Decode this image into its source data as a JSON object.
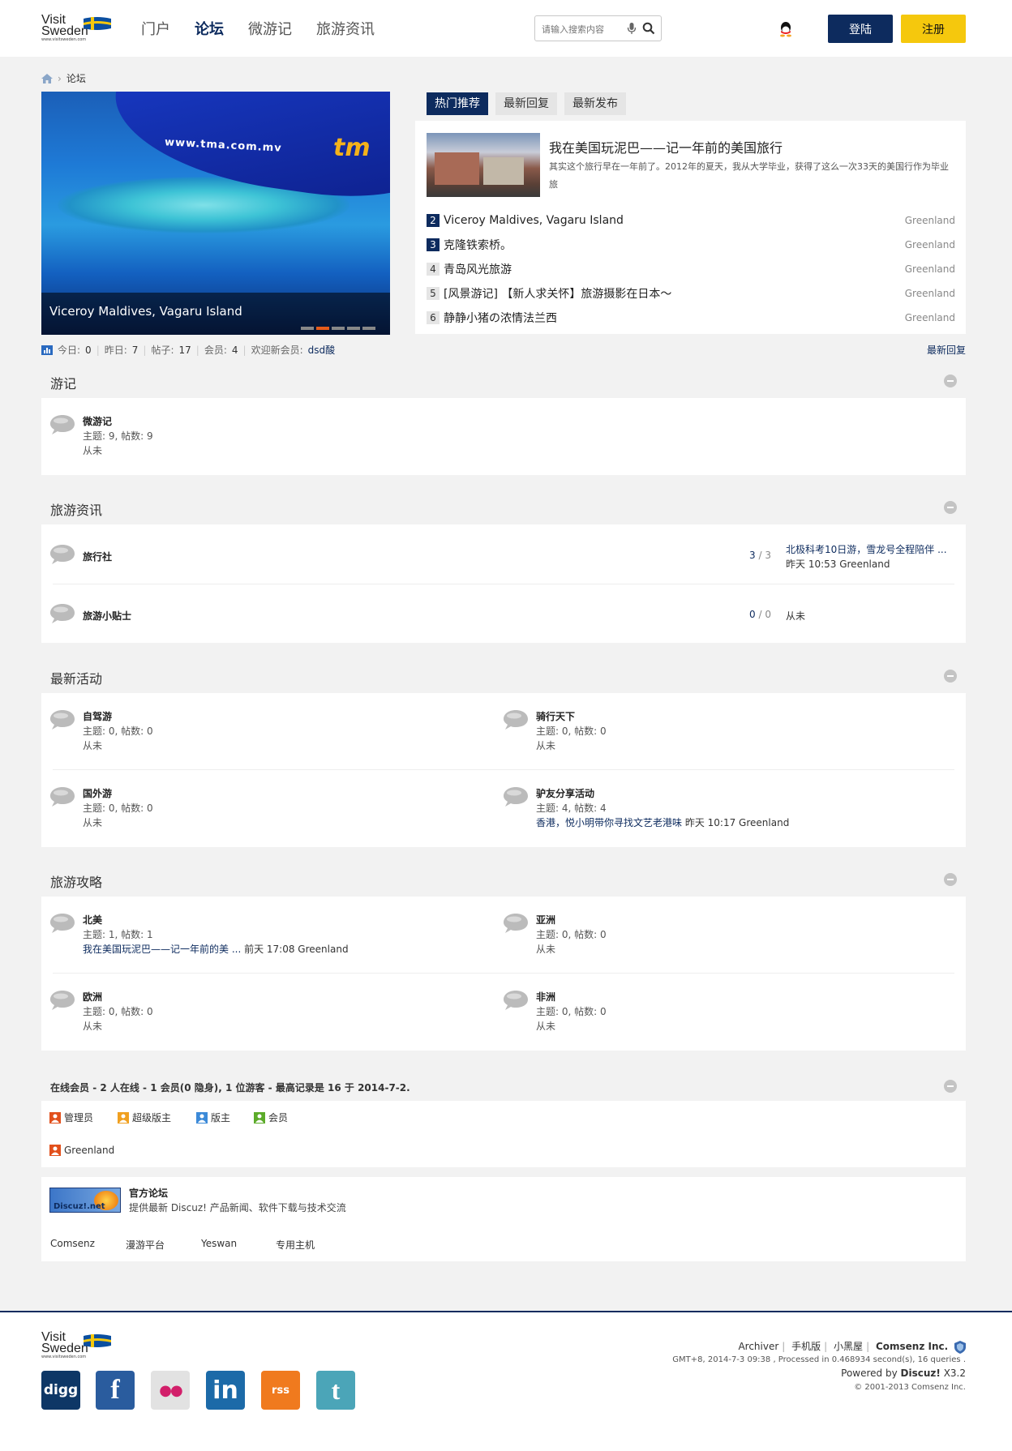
{
  "header": {
    "logo_line1": "Visit",
    "logo_line2": "Sweden",
    "logo_line3": "www.visitsweden.com",
    "nav": [
      "门户",
      "论坛",
      "微游记",
      "旅游资讯"
    ],
    "search_placeholder": "请输入搜索内容",
    "login": "登陆",
    "register": "注册"
  },
  "breadcrumb": {
    "current": "论坛"
  },
  "slideshow": {
    "wing_text": "www.tma.com.mv",
    "brand_text": "tm",
    "caption": "Viceroy Maldives, Vagaru Island",
    "active_dot": 1
  },
  "hot_tabs": [
    "热门推荐",
    "最新回复",
    "最新发布"
  ],
  "hot": {
    "featured_title": "我在美国玩泥巴——记一年前的美国旅行",
    "featured_desc": "其实这个旅行早在一年前了。2012年的夏天，我从大学毕业，获得了这么一次33天的美国行作为毕业旅",
    "items": [
      {
        "num": "2",
        "title": "Viceroy Maldives, Vagaru Island",
        "author": "Greenland"
      },
      {
        "num": "3",
        "title": "克隆铁索桥。",
        "author": "Greenland"
      },
      {
        "num": "4",
        "title": "青岛风光旅游",
        "author": "Greenland"
      },
      {
        "num": "5",
        "title": "[风景游记] 【新人求关怀】旅游摄影在日本～",
        "author": "Greenland"
      },
      {
        "num": "6",
        "title": "静静小猪の浓情法兰西",
        "author": "Greenland"
      }
    ]
  },
  "stats": {
    "today_label": "今日:",
    "today": "0",
    "yesterday_label": "昨日:",
    "yesterday": "7",
    "posts_label": "帖子:",
    "posts": "17",
    "members_label": "会员:",
    "members": "4",
    "welcome_label": "欢迎新会员:",
    "newest": "dsd酸",
    "latest_reply": "最新回复"
  },
  "sections": {
    "youji": {
      "title": "游记",
      "forums": [
        {
          "name": "微游记",
          "meta": "主题: 9, 帖数: 9",
          "last": "从未"
        }
      ]
    },
    "zixun": {
      "title": "旅游资讯",
      "forums": [
        {
          "name": "旅行社",
          "topics": "3",
          "posts": "3",
          "last_title": "北极科考10日游，雪龙号全程陪伴 ...",
          "last_time": "昨天 10:53 Greenland"
        },
        {
          "name": "旅游小贴士",
          "topics": "0",
          "posts": "0",
          "last_title": "从未"
        }
      ]
    },
    "huodong": {
      "title": "最新活动",
      "forums": [
        {
          "name": "自驾游",
          "meta": "主题: 0, 帖数: 0",
          "last": "从未"
        },
        {
          "name": "骑行天下",
          "meta": "主题: 0, 帖数: 0",
          "last": "从未"
        },
        {
          "name": "国外游",
          "meta": "主题: 0, 帖数: 0",
          "last": "从未"
        },
        {
          "name": "驴友分享活动",
          "meta": "主题: 4, 帖数: 4",
          "last_title": "香港，悦小明带你寻找文艺老港味",
          "last_time": "昨天 10:17 Greenland"
        }
      ]
    },
    "gonglue": {
      "title": "旅游攻略",
      "forums": [
        {
          "name": "北美",
          "meta": "主题: 1, 帖数: 1",
          "last_title": "我在美国玩泥巴——记一年前的美 ...",
          "last_time": "前天 17:08 Greenland"
        },
        {
          "name": "亚洲",
          "meta": "主题: 0, 帖数: 0",
          "last": "从未"
        },
        {
          "name": "欧洲",
          "meta": "主题: 0, 帖数: 0",
          "last": "从未"
        },
        {
          "name": "非洲",
          "meta": "主题: 0, 帖数: 0",
          "last": "从未"
        }
      ]
    }
  },
  "online": {
    "title": "在线会员",
    "summary": " - 2 人在线 - 1 会员(0 隐身), 1 位游客 - 最高记录是 16 于 2014-7-2.",
    "roles": [
      "管理员",
      "超级版主",
      "版主",
      "会员"
    ],
    "users": [
      "Greenland"
    ]
  },
  "links": {
    "logo_text": "Discuz!.net",
    "official_title": "官方论坛",
    "official_desc": "提供最新 Discuz! 产品新闻、软件下载与技术交流",
    "partners": [
      "Comsenz",
      "漫游平台",
      "Yeswan",
      "专用主机"
    ]
  },
  "footer": {
    "links": [
      "Archiver",
      "手机版",
      "小黑屋"
    ],
    "company": "Comsenz Inc.",
    "info": "GMT+8, 2014-7-3 09:38 , Processed in 0.468934 second(s), 16 queries .",
    "powered_prefix": "Powered by ",
    "powered_brand": "Discuz!",
    "powered_version": " X3.2",
    "copyright": "© 2001-2013 Comsenz Inc.",
    "social": [
      "digg",
      "f",
      "●●",
      "in",
      "rss",
      "t"
    ]
  },
  "colors": {
    "brand_navy": "#0d2b5e",
    "register_yellow": "#f5c80d",
    "slide_dot_active": "#e65b1a"
  }
}
